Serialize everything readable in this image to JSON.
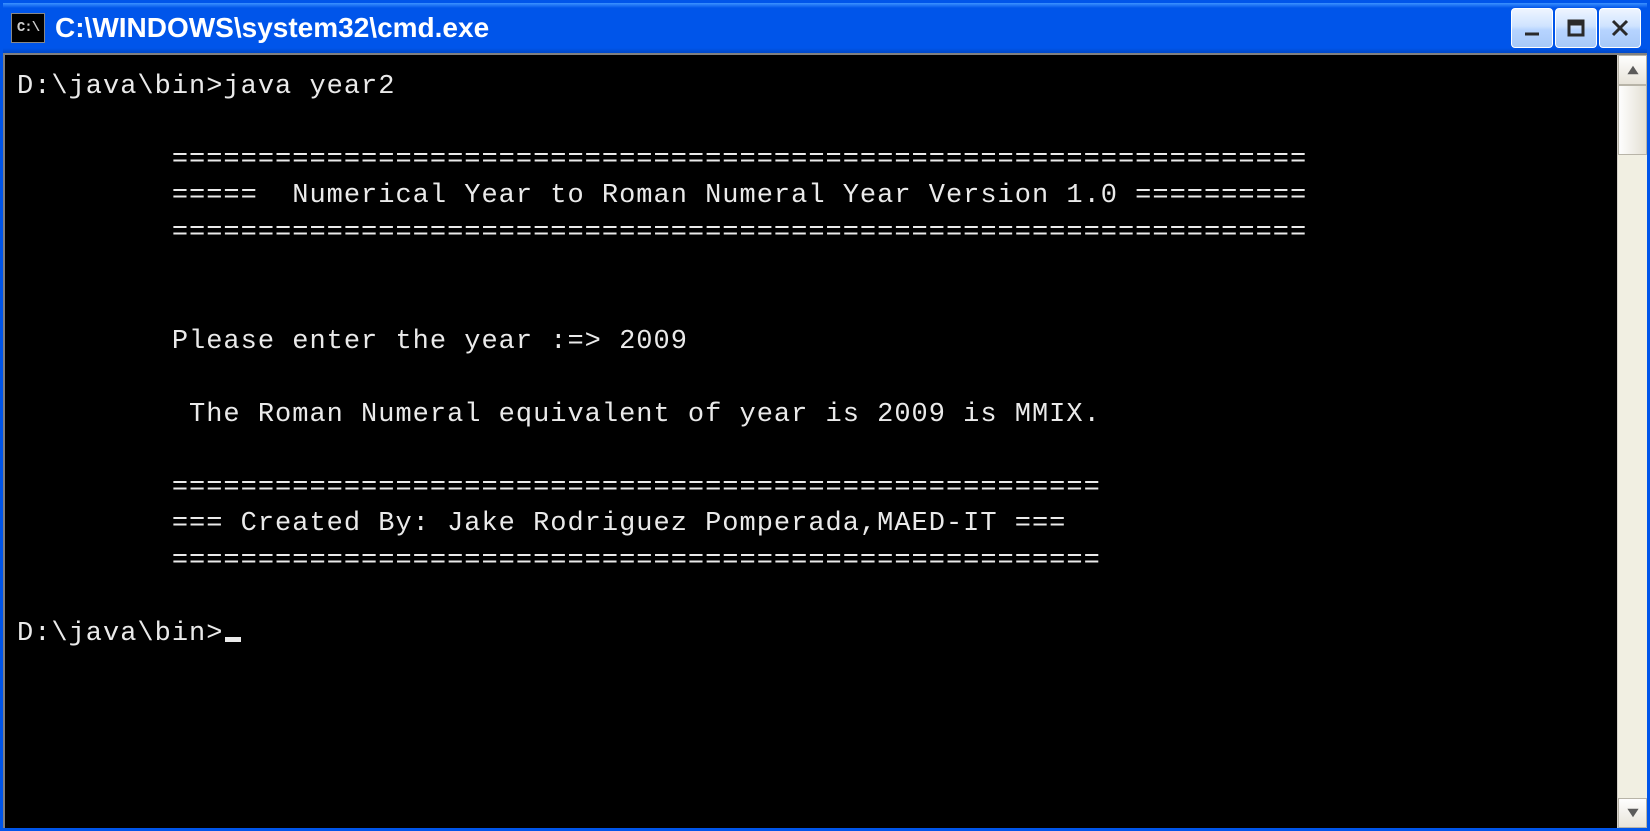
{
  "window": {
    "title": "C:\\WINDOWS\\system32\\cmd.exe",
    "icon_label": "C:\\"
  },
  "console": {
    "lines": [
      "D:\\java\\bin>java year2",
      "",
      "         ==================================================================",
      "         =====  Numerical Year to Roman Numeral Year Version 1.0 ==========",
      "         ==================================================================",
      "",
      "",
      "         Please enter the year :=> 2009",
      "",
      "          The Roman Numeral equivalent of year is 2009 is MMIX.",
      "",
      "         ======================================================",
      "         === Created By: Jake Rodriguez Pomperada,MAED-IT ===",
      "         ======================================================",
      "",
      "D:\\java\\bin>"
    ],
    "show_cursor": true
  }
}
